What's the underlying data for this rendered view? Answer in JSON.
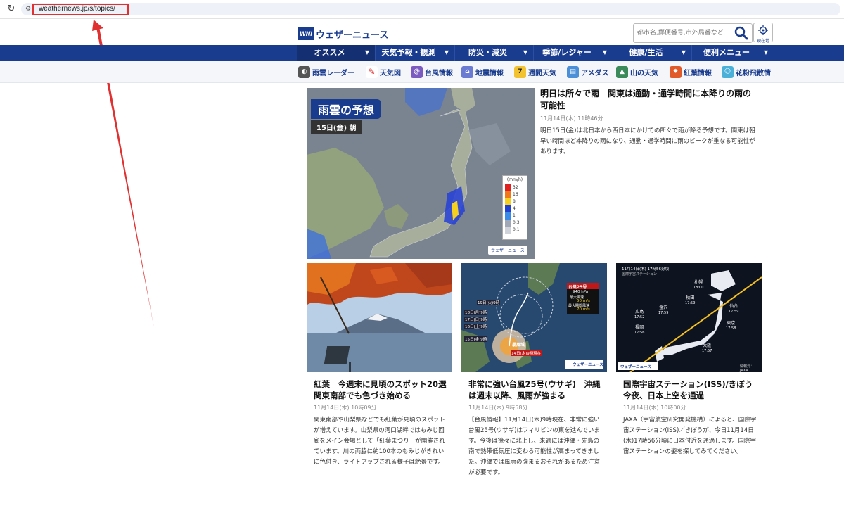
{
  "browser": {
    "url": "weathernews.jp/s/topics/",
    "reload_icon": "reload-icon",
    "site_icon": "site-info-icon"
  },
  "header": {
    "logo_mark": "WNI",
    "logo_text": "ウェザーニュース",
    "search_placeholder": "都市名,郵便番号,市外局番など",
    "current_location_label": "現在地"
  },
  "nav": {
    "items": [
      {
        "label": "オススメ"
      },
      {
        "label": "天気予報・観測"
      },
      {
        "label": "防災・減災"
      },
      {
        "label": "季節/レジャー"
      },
      {
        "label": "健康/生活"
      },
      {
        "label": "便利メニュー"
      }
    ],
    "active_index": 0
  },
  "subnav": {
    "items": [
      {
        "label": "雨雲レーダー",
        "icon": "radar-icon",
        "color": "#555555"
      },
      {
        "label": "天気図",
        "icon": "weather-map-icon",
        "color": "#ffffff"
      },
      {
        "label": "台風情報",
        "icon": "typhoon-icon",
        "color": "#7b5bbf"
      },
      {
        "label": "地震情報",
        "icon": "earthquake-icon",
        "color": "#6a7bd1"
      },
      {
        "label": "週間天気",
        "icon": "weekly-calendar-icon",
        "color": "#f2c230"
      },
      {
        "label": "アメダス",
        "icon": "amedas-icon",
        "color": "#4a8fd8"
      },
      {
        "label": "山の天気",
        "icon": "mountain-icon",
        "color": "#3a8a5a"
      },
      {
        "label": "紅葉情報",
        "icon": "maple-leaf-icon",
        "color": "#e05a2a"
      },
      {
        "label": "花粉飛散情",
        "icon": "pollen-icon",
        "color": "#4ab0d8"
      }
    ]
  },
  "hero": {
    "image_title": "雨雲の予想",
    "image_date": "15日(金) 朝",
    "legend_unit": "(mm/h)",
    "legend_values": [
      "32",
      "16",
      "8",
      "4",
      "1",
      "0.3",
      "0.1"
    ],
    "legend_colors": [
      "#e02020",
      "#f07818",
      "#f5d020",
      "#2040d0",
      "#3a8ae8",
      "#a0a8b8",
      "#d0d4da"
    ],
    "brand": "ウェザーニュース",
    "headline": "明日は所々で雨　関東は通勤・通学時間に本降りの雨の可能性",
    "meta": "11月14日(木) 11時46分",
    "body": "明日15日(金)は北日本から西日本にかけての所々で雨が降る予想です。関東は朝早い時間ほど本降りの雨になり、通勤・通学時間に雨のピークが重なる可能性があります。"
  },
  "cards": [
    {
      "headline": "紅葉　今週末に見頃のスポット20選　関東南部でも色づき始める",
      "meta": "11月14日(木) 10時09分",
      "body": "関東南部や山梨県などでも紅葉が見頃のスポットが増えています。山梨県の河口湖畔ではもみじ回廊をメイン会場として「紅葉まつり」が開催されています。川の両脇に約100本のもみじがきれいに色付き、ライトアップされる様子は絶景です。"
    },
    {
      "headline": "非常に強い台風25号(ウサギ)　沖縄は週末以降、風雨が強まる",
      "meta": "11月14日(木) 9時58分",
      "body": "【台風情報】11月14日(木)9時現在、非常に強い台風25号(ウサギ)はフィリピンの東を進んでいます。今後は徐々に北上し、来週には沖縄・先島の南で熱帯低気圧に変わる可能性が高まってきました。沖縄では風雨の強まるおそれがあるため注意が必要です。",
      "image_labels": {
        "title": "台風25号",
        "pressure": "940 hPa",
        "max_wind_label": "最大風速",
        "max_wind": "50 m/s",
        "max_gust_label": "最大瞬間風速",
        "max_gust": "70 m/s",
        "t1": "19日(火)9時",
        "t2": "18日(月)9時",
        "t3": "17日(日)9時",
        "t4": "16日(土)9時",
        "t5": "15日(金)9時",
        "now": "14日(木)9時現在",
        "storm": "暴風域",
        "brand": "ウェザーニュース"
      }
    },
    {
      "headline": "国際宇宙ステーション(ISS)/きぼう　今夜、日本上空を通過",
      "meta": "11月14日(木) 10時00分",
      "body": "JAXA（宇宙航空研究開発機構）によると、国際宇宙ステーション(ISS)／きぼうが、今日11月14日(木)17時56分頃に日本付近を通過します。国際宇宙ステーションの姿を探してみてください。",
      "image_labels": {
        "top": "11月14日(木) 17時56分頃",
        "sub": "国際宇宙ステーション",
        "cities": [
          {
            "name": "札幌",
            "time": "18:00"
          },
          {
            "name": "秋田",
            "time": "17:59"
          },
          {
            "name": "仙台",
            "time": "17:59"
          },
          {
            "name": "金沢",
            "time": "17:59"
          },
          {
            "name": "広島",
            "time": "17:52"
          },
          {
            "name": "東京",
            "time": "17:58"
          },
          {
            "name": "福岡",
            "time": "17:56"
          },
          {
            "name": "大阪",
            "time": "17:57"
          }
        ],
        "credit": "情報元：JAXA",
        "brand": "ウェザーニュース"
      }
    }
  ]
}
